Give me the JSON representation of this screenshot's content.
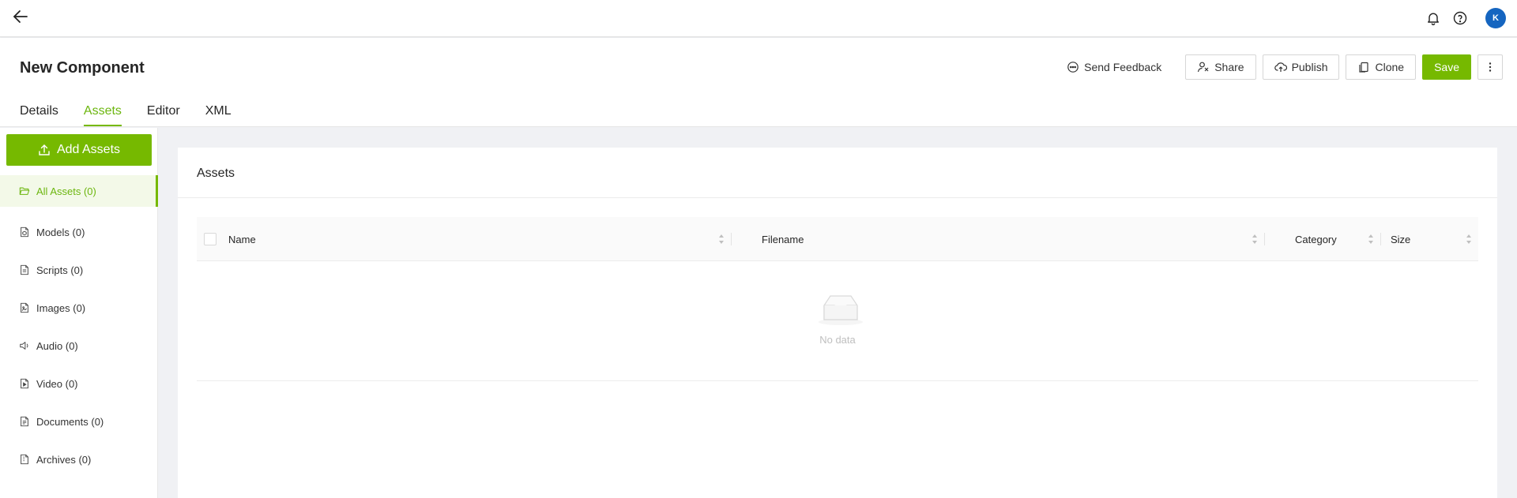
{
  "topbar": {
    "back_icon": "arrow-left-icon",
    "notification_icon": "bell-icon",
    "help_icon": "question-circle-icon",
    "avatar_initial": "K",
    "avatar_color": "#1565c0"
  },
  "header": {
    "title": "New Component",
    "tabs": [
      {
        "label": "Details",
        "active": false
      },
      {
        "label": "Assets",
        "active": true
      },
      {
        "label": "Editor",
        "active": false
      },
      {
        "label": "XML",
        "active": false
      }
    ],
    "actions": {
      "feedback_label": "Send Feedback",
      "share_label": "Share",
      "publish_label": "Publish",
      "clone_label": "Clone",
      "save_label": "Save"
    }
  },
  "sidebar": {
    "add_assets_label": "Add Assets",
    "items": [
      {
        "label": "All Assets (0)",
        "icon": "folder-open-icon",
        "active": true
      },
      {
        "label": "Models (0)",
        "icon": "file-model-icon",
        "active": false
      },
      {
        "label": "Scripts (0)",
        "icon": "file-script-icon",
        "active": false
      },
      {
        "label": "Images (0)",
        "icon": "file-image-icon",
        "active": false
      },
      {
        "label": "Audio (0)",
        "icon": "speaker-icon",
        "active": false
      },
      {
        "label": "Video (0)",
        "icon": "file-video-icon",
        "active": false
      },
      {
        "label": "Documents (0)",
        "icon": "file-document-icon",
        "active": false
      },
      {
        "label": "Archives (0)",
        "icon": "file-archive-icon",
        "active": false
      }
    ]
  },
  "main": {
    "card_title": "Assets",
    "columns": [
      "Name",
      "Filename",
      "Category",
      "Size"
    ],
    "empty_text": "No data"
  },
  "colors": {
    "accent": "#76b900",
    "accent_text": "#6cb60f",
    "background": "#f0f1f4"
  }
}
